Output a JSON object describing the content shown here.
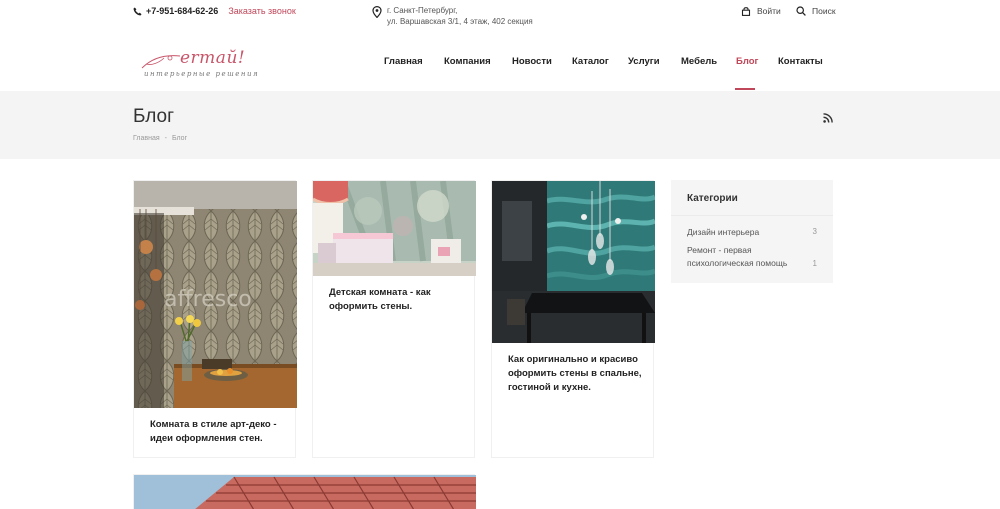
{
  "topbar": {
    "phone": "+7-951-684-62-26",
    "call_link": "Заказать звонок",
    "address_line1": "г. Санкт-Петербург,",
    "address_line2": "ул. Варшавская 3/1, 4 этаж, 402 секция",
    "login": "Войти",
    "search": "Поиск"
  },
  "logo": {
    "script": "ermaŭ!",
    "tagline": "интерьерные решения"
  },
  "nav": [
    {
      "label": "Главная",
      "active": false
    },
    {
      "label": "Компания",
      "active": false
    },
    {
      "label": "Новости",
      "active": false
    },
    {
      "label": "Каталог",
      "active": false
    },
    {
      "label": "Услуги",
      "active": false
    },
    {
      "label": "Мебель",
      "active": false
    },
    {
      "label": "Блог",
      "active": true
    },
    {
      "label": "Контакты",
      "active": false
    }
  ],
  "page": {
    "title": "Блог",
    "breadcrumb": [
      "Главная",
      "Блог"
    ]
  },
  "posts": [
    {
      "title": "Комната в стиле арт-деко - идеи оформления стен.",
      "watermark": "affresco"
    },
    {
      "title": "Детская комната - как оформить стены."
    },
    {
      "title": "Как оригинально и красиво оформить стены в спальне, гостиной и кухне."
    }
  ],
  "sidebar": {
    "title": "Категории",
    "categories": [
      {
        "label": "Дизайн интерьера",
        "count": "3"
      },
      {
        "label": "Ремонт - первая психологическая помощь",
        "count": "1"
      }
    ]
  },
  "colors": {
    "accent": "#c0475a",
    "band": "#f4f4f4"
  }
}
